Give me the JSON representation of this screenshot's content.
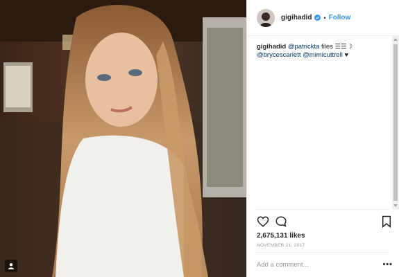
{
  "post": {
    "username": "gigihadid",
    "follow_label": "Follow",
    "dot": "•",
    "caption": {
      "author": "gigihadid",
      "mention1": "@patrickta",
      "text1": " files ☰☰☽",
      "mention2": "@brycescarlett",
      "mention3": "@mimicuttrell",
      "text2": " ♥"
    },
    "likes": "2,675,131 likes",
    "date": "NOVEMBER 21, 2017",
    "comment_placeholder": "Add a comment...",
    "more": "•••"
  },
  "icons": {
    "like": "heart-icon",
    "comment": "comment-icon",
    "save": "bookmark-icon",
    "verified": "verified-badge-icon",
    "photo_badge": "user-tag-icon"
  },
  "colors": {
    "link": "#3897f0",
    "mention": "#003569",
    "text": "#262626",
    "muted": "#999999"
  }
}
